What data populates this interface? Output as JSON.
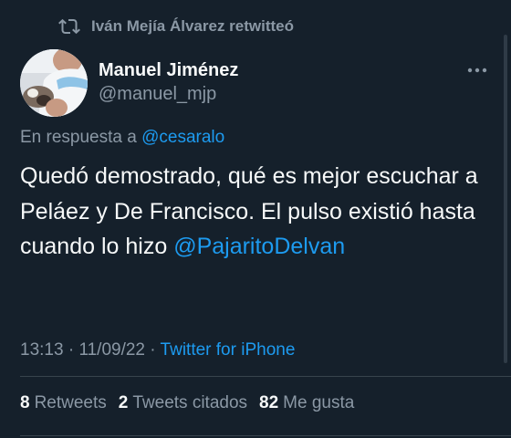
{
  "retweet": {
    "icon": "retweet-icon",
    "text": "Iván Mejía Álvarez retwitteó"
  },
  "author": {
    "name": "Manuel Jiménez",
    "handle": "@manuel_mjp",
    "avatar_icon": "avatar-photo"
  },
  "more_icon": "more-dots-icon",
  "reply": {
    "prefix": "En respuesta a",
    "mention": "@cesaralo"
  },
  "tweet": {
    "text": "Quedó demostrado, qué es mejor escuchar a Peláez y De Francisco. El pulso existió hasta cuando lo hizo",
    "mention": "@PajaritoDelvan"
  },
  "meta": {
    "time": "13:13",
    "separator1": "·",
    "date": "11/09/22",
    "separator2": "·",
    "source": "Twitter for iPhone"
  },
  "stats": {
    "retweets_count": "8",
    "retweets_label": "Retweets",
    "quotes_count": "2",
    "quotes_label": "Tweets citados",
    "likes_count": "82",
    "likes_label": "Me gusta"
  },
  "colors": {
    "background": "#15202b",
    "text": "#f7f9f9",
    "secondary": "#8b98a5",
    "link": "#1d9bf0",
    "divider": "#38444d"
  }
}
